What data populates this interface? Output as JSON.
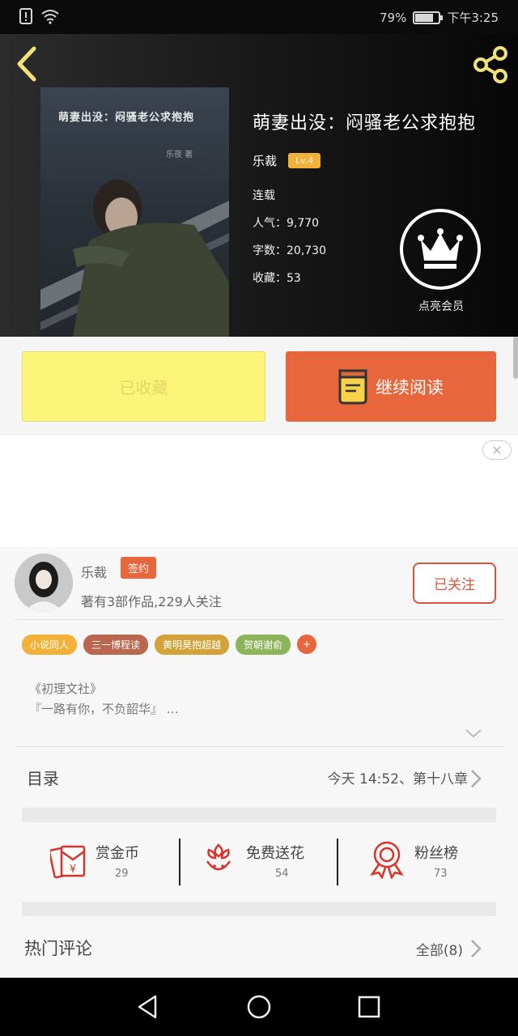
{
  "status_bar": {
    "battery": "79%",
    "time": "下午3:25",
    "battery_level": 0.79
  },
  "header": {
    "cover": {
      "title": "萌妻出没：闷骚老公求抱抱",
      "author": "乐夜 著"
    },
    "book": {
      "title": "萌妻出没：闷骚老公求抱抱",
      "author": "乐裁",
      "level": "Lv.4",
      "status": "连载",
      "popularity": "人气：9,770",
      "word_count": "字数：20,730",
      "favorites": "收藏：53"
    },
    "crown_label": "点亮会员"
  },
  "actions": {
    "fav_label": "已收藏",
    "read_label": "继续阅读"
  },
  "author_card": {
    "name": "乐裁",
    "badge": "签约",
    "stats": "著有3部作品,229人关注",
    "follow_label": "已关注",
    "tags": [
      {
        "label": "小说同人",
        "color": "#f2b23a"
      },
      {
        "label": "三一博程读",
        "color": "#b9674f"
      },
      {
        "label": "黄明昊抱超越",
        "color": "#d4a23a"
      },
      {
        "label": "贺朝谢俞",
        "color": "#8db45b"
      }
    ],
    "tag_more": "+",
    "intro_line1": "《初理文社》",
    "intro_line2": "『一路有你，不负韶华』 …"
  },
  "toc": {
    "label": "目录",
    "latest": "今天 14:52、第十八章"
  },
  "gifts": [
    {
      "label": "赏金币",
      "count": "29",
      "icon": "red-envelope-icon"
    },
    {
      "label": "免费送花",
      "count": "54",
      "icon": "flower-icon"
    },
    {
      "label": "粉丝榜",
      "count": "73",
      "icon": "medal-icon"
    }
  ],
  "comments": {
    "label": "热门评论",
    "all": "全部(8)"
  },
  "colors": {
    "accent": "#e8663c",
    "fav_button": "#fdf57a",
    "level_badge": "#f2b23a",
    "follow_border": "#d9543a"
  }
}
